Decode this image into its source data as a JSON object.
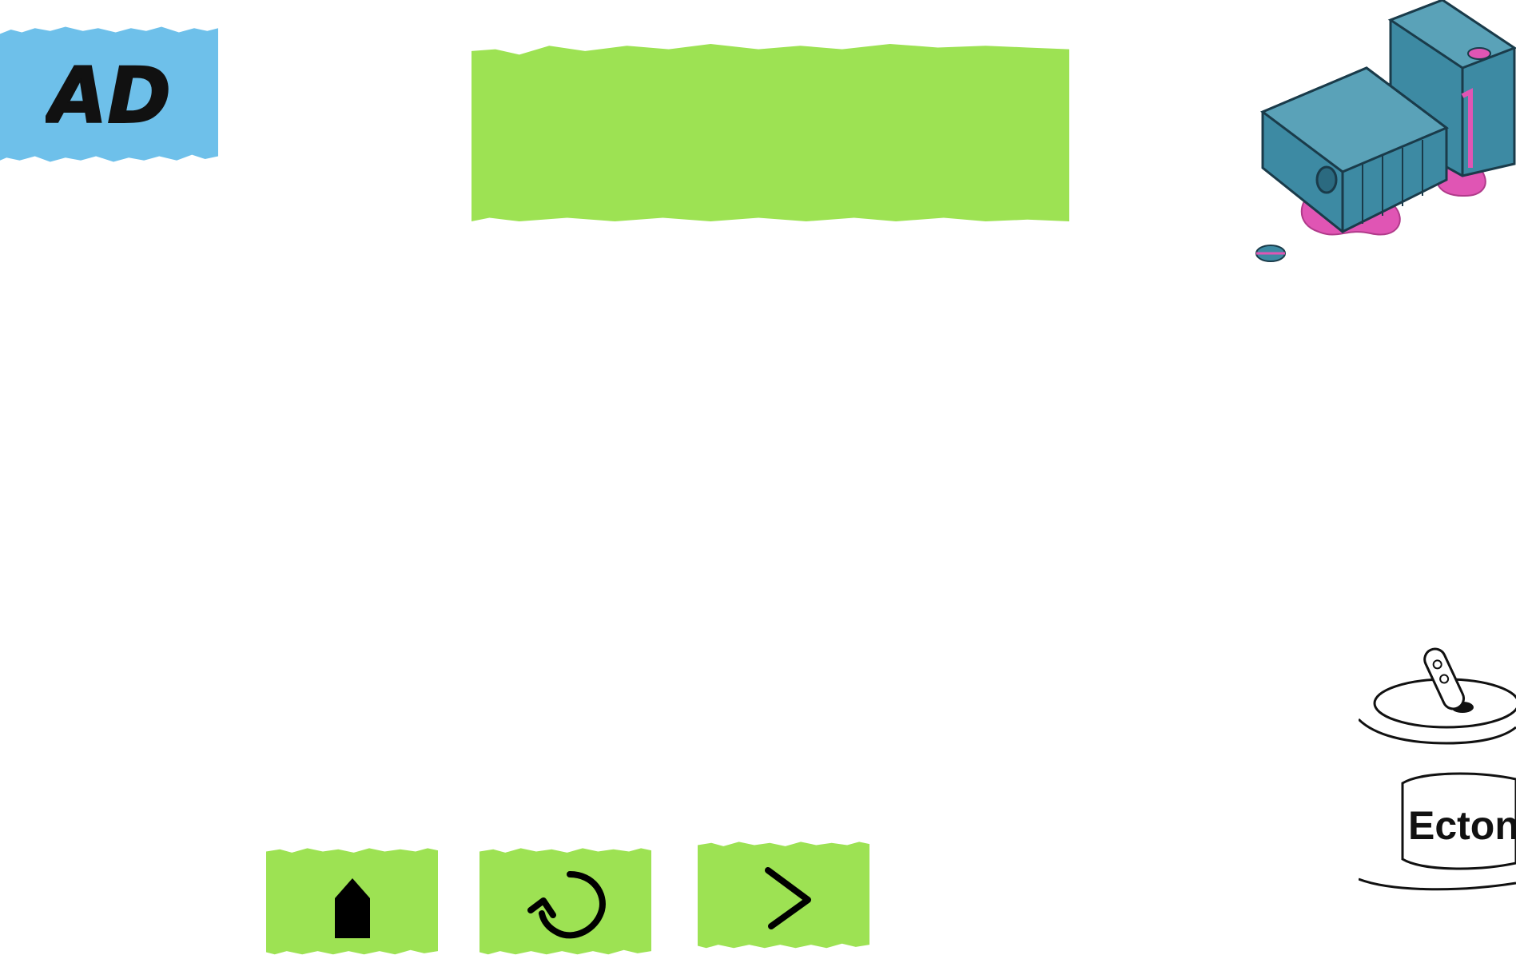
{
  "ad_badge": {
    "label": "AD"
  },
  "title_banner": {
    "text": ""
  },
  "buttons": {
    "home": {
      "icon": "home-icon"
    },
    "replay": {
      "icon": "replay-icon"
    },
    "next": {
      "icon": "chevron-right-icon"
    }
  },
  "decor": {
    "machine": {
      "icon": "toppled-machine-icon"
    },
    "paint_can": {
      "label": "Ecton"
    }
  },
  "colors": {
    "ad_blue": "#6ec0ea",
    "button_green": "#9de253",
    "machine_teal": "#3d8aa3",
    "spill_pink": "#e055b4"
  }
}
